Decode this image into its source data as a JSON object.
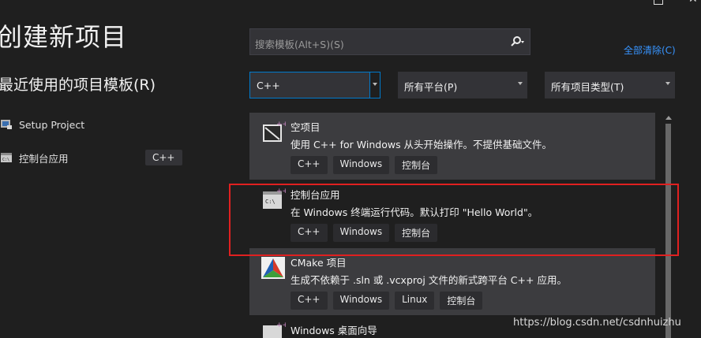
{
  "header": {
    "title": "创建新项目",
    "recent_heading": "最近使用的项目模板(R)"
  },
  "recent_templates": [
    {
      "name": "Setup Project",
      "lang": ""
    },
    {
      "name": "控制台应用",
      "lang": "C++"
    }
  ],
  "search": {
    "placeholder": "搜索模板(Alt+S)(S)",
    "clear_all": "全部清除(C)"
  },
  "filters": {
    "language": "C++",
    "platform": "所有平台(P)",
    "project_type": "所有项目类型(T)"
  },
  "templates": [
    {
      "title": "空项目",
      "description": "使用 C++ for Windows 从头开始操作。不提供基础文件。",
      "tags": [
        "C++",
        "Windows",
        "控制台"
      ]
    },
    {
      "title": "控制台应用",
      "description": "在 Windows 终端运行代码。默认打印 \"Hello World\"。",
      "tags": [
        "C++",
        "Windows",
        "控制台"
      ]
    },
    {
      "title": "CMake 项目",
      "description": "生成不依赖于 .sln 或 .vcxproj 文件的新式跨平台 C++ 应用。",
      "tags": [
        "C++",
        "Windows",
        "Linux",
        "控制台"
      ]
    },
    {
      "title": "Windows 桌面向导",
      "description": "",
      "tags": []
    }
  ],
  "watermark": "https://blog.csdn.net/csdnhuizhu",
  "colors": {
    "accent": "#007acc",
    "link": "#3794ff",
    "highlight_box": "#e02020",
    "background": "#1f1f1f"
  }
}
